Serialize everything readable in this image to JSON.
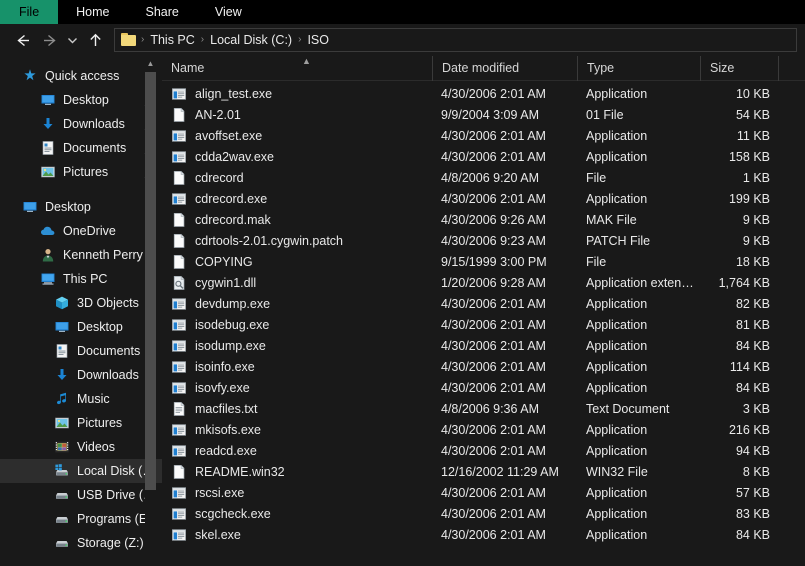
{
  "ribbon": {
    "tabs": [
      {
        "label": "File",
        "active": true
      },
      {
        "label": "Home",
        "active": false
      },
      {
        "label": "Share",
        "active": false
      },
      {
        "label": "View",
        "active": false
      }
    ]
  },
  "toolbar": {
    "back_icon": "arrow-left-icon",
    "forward_icon": "arrow-right-icon",
    "recent_icon": "chevron-down-icon",
    "up_icon": "arrow-up-icon"
  },
  "breadcrumb": {
    "folder_icon": "folder-icon",
    "separator": "›",
    "items": [
      "This PC",
      "Local Disk (C:)",
      "ISO"
    ]
  },
  "sidebar": {
    "scroll_up_icon": "chevron-up-icon",
    "groups": [
      {
        "header": {
          "label": "Quick access",
          "icon": "star-icon",
          "level": 0
        },
        "items": [
          {
            "label": "Desktop",
            "icon": "monitor-icon",
            "level": 1,
            "pinned": true
          },
          {
            "label": "Downloads",
            "icon": "download-icon",
            "level": 1,
            "pinned": true
          },
          {
            "label": "Documents",
            "icon": "document-icon",
            "level": 1,
            "pinned": true
          },
          {
            "label": "Pictures",
            "icon": "picture-icon",
            "level": 1,
            "pinned": true
          }
        ]
      },
      {
        "header": {
          "label": "Desktop",
          "icon": "monitor-icon",
          "level": 0
        },
        "items": [
          {
            "label": "OneDrive",
            "icon": "cloud-icon",
            "level": 1,
            "pinned": false
          },
          {
            "label": "Kenneth Perry",
            "icon": "user-icon",
            "level": 1,
            "pinned": false
          },
          {
            "label": "This PC",
            "icon": "thispc-icon",
            "level": 1,
            "pinned": false
          },
          {
            "label": "3D Objects",
            "icon": "cube-icon",
            "level": 2,
            "pinned": false
          },
          {
            "label": "Desktop",
            "icon": "monitor-icon",
            "level": 2,
            "pinned": false
          },
          {
            "label": "Documents",
            "icon": "document-icon",
            "level": 2,
            "pinned": false
          },
          {
            "label": "Downloads",
            "icon": "download-icon",
            "level": 2,
            "pinned": false
          },
          {
            "label": "Music",
            "icon": "music-icon",
            "level": 2,
            "pinned": false
          },
          {
            "label": "Pictures",
            "icon": "picture-icon",
            "level": 2,
            "pinned": false
          },
          {
            "label": "Videos",
            "icon": "video-icon",
            "level": 2,
            "pinned": false
          },
          {
            "label": "Local Disk (C:)",
            "icon": "windows-drive-icon",
            "level": 2,
            "pinned": false,
            "selected": true
          },
          {
            "label": "USB Drive (D:)",
            "icon": "drive-icon",
            "level": 2,
            "pinned": false
          },
          {
            "label": "Programs (E:)",
            "icon": "drive-icon",
            "level": 2,
            "pinned": false
          },
          {
            "label": "Storage (Z:)",
            "icon": "drive-icon",
            "level": 2,
            "pinned": false
          }
        ]
      }
    ]
  },
  "filelist": {
    "columns": [
      "Name",
      "Date modified",
      "Type",
      "Size"
    ],
    "sort_column": "Name",
    "sort_direction": "ascending",
    "rows": [
      {
        "name": "align_test.exe",
        "icon": "exe-icon",
        "date": "4/30/2006 2:01 AM",
        "type": "Application",
        "size": "10 KB"
      },
      {
        "name": "AN-2.01",
        "icon": "file-icon",
        "date": "9/9/2004 3:09 AM",
        "type": "01 File",
        "size": "54 KB"
      },
      {
        "name": "avoffset.exe",
        "icon": "exe-icon",
        "date": "4/30/2006 2:01 AM",
        "type": "Application",
        "size": "11 KB"
      },
      {
        "name": "cdda2wav.exe",
        "icon": "exe-icon",
        "date": "4/30/2006 2:01 AM",
        "type": "Application",
        "size": "158 KB"
      },
      {
        "name": "cdrecord",
        "icon": "file-icon",
        "date": "4/8/2006 9:20 AM",
        "type": "File",
        "size": "1 KB"
      },
      {
        "name": "cdrecord.exe",
        "icon": "exe-icon",
        "date": "4/30/2006 2:01 AM",
        "type": "Application",
        "size": "199 KB"
      },
      {
        "name": "cdrecord.mak",
        "icon": "file-icon",
        "date": "4/30/2006 9:26 AM",
        "type": "MAK File",
        "size": "9 KB"
      },
      {
        "name": "cdrtools-2.01.cygwin.patch",
        "icon": "file-icon",
        "date": "4/30/2006 9:23 AM",
        "type": "PATCH File",
        "size": "9 KB"
      },
      {
        "name": "COPYING",
        "icon": "file-icon",
        "date": "9/15/1999 3:00 PM",
        "type": "File",
        "size": "18 KB"
      },
      {
        "name": "cygwin1.dll",
        "icon": "dll-icon",
        "date": "1/20/2006 9:28 AM",
        "type": "Application exten…",
        "size": "1,764 KB"
      },
      {
        "name": "devdump.exe",
        "icon": "exe-icon",
        "date": "4/30/2006 2:01 AM",
        "type": "Application",
        "size": "82 KB"
      },
      {
        "name": "isodebug.exe",
        "icon": "exe-icon",
        "date": "4/30/2006 2:01 AM",
        "type": "Application",
        "size": "81 KB"
      },
      {
        "name": "isodump.exe",
        "icon": "exe-icon",
        "date": "4/30/2006 2:01 AM",
        "type": "Application",
        "size": "84 KB"
      },
      {
        "name": "isoinfo.exe",
        "icon": "exe-icon",
        "date": "4/30/2006 2:01 AM",
        "type": "Application",
        "size": "114 KB"
      },
      {
        "name": "isovfy.exe",
        "icon": "exe-icon",
        "date": "4/30/2006 2:01 AM",
        "type": "Application",
        "size": "84 KB"
      },
      {
        "name": "macfiles.txt",
        "icon": "text-icon",
        "date": "4/8/2006 9:36 AM",
        "type": "Text Document",
        "size": "3 KB"
      },
      {
        "name": "mkisofs.exe",
        "icon": "exe-icon",
        "date": "4/30/2006 2:01 AM",
        "type": "Application",
        "size": "216 KB"
      },
      {
        "name": "readcd.exe",
        "icon": "exe-icon",
        "date": "4/30/2006 2:01 AM",
        "type": "Application",
        "size": "94 KB"
      },
      {
        "name": "README.win32",
        "icon": "file-icon",
        "date": "12/16/2002 11:29 AM",
        "type": "WIN32 File",
        "size": "8 KB"
      },
      {
        "name": "rscsi.exe",
        "icon": "exe-icon",
        "date": "4/30/2006 2:01 AM",
        "type": "Application",
        "size": "57 KB"
      },
      {
        "name": "scgcheck.exe",
        "icon": "exe-icon",
        "date": "4/30/2006 2:01 AM",
        "type": "Application",
        "size": "83 KB"
      },
      {
        "name": "skel.exe",
        "icon": "exe-icon",
        "date": "4/30/2006 2:01 AM",
        "type": "Application",
        "size": "84 KB"
      }
    ]
  },
  "colors": {
    "file_tab_green": "#17926a",
    "background": "#191919",
    "selection": "#2d2d2d",
    "accent_blue": "#1c8ad4",
    "folder_yellow": "#f2d87a"
  }
}
